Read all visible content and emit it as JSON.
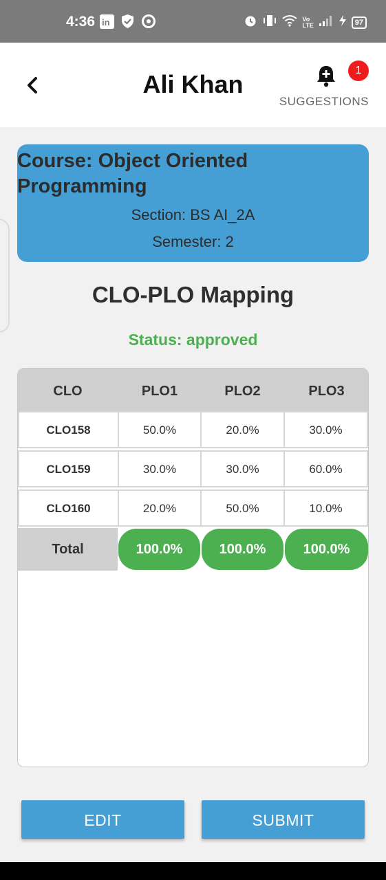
{
  "status_bar": {
    "time": "4:36",
    "battery": "97",
    "volte_top": "Vo",
    "volte_bottom": "LTE"
  },
  "app_bar": {
    "title": "Ali Khan",
    "notification_count": "1",
    "suggestions_label": "SUGGESTIONS"
  },
  "course": {
    "name": "Course: Object Oriented Programming",
    "section": "Section: BS AI_2A",
    "semester": "Semester: 2",
    "card_color": "#459fd4"
  },
  "mapping": {
    "heading": "CLO-PLO Mapping",
    "status": "Status: approved",
    "status_color": "#4caf50"
  },
  "table": {
    "headers": [
      "CLO",
      "PLO1",
      "PLO2",
      "PLO3"
    ],
    "rows": [
      {
        "clo": "CLO158",
        "values": [
          "50.0%",
          "20.0%",
          "30.0%"
        ]
      },
      {
        "clo": "CLO159",
        "values": [
          "30.0%",
          "30.0%",
          "60.0%"
        ]
      },
      {
        "clo": "CLO160",
        "values": [
          "20.0%",
          "50.0%",
          "10.0%"
        ]
      }
    ],
    "total_label": "Total",
    "totals": [
      "100.0%",
      "100.0%",
      "100.0%"
    ],
    "total_color": "#4caf50"
  },
  "actions": {
    "edit_label": "EDIT",
    "submit_label": "SUBMIT"
  },
  "icons": {
    "back": "back-arrow-icon",
    "bell": "bell-plus-icon"
  }
}
